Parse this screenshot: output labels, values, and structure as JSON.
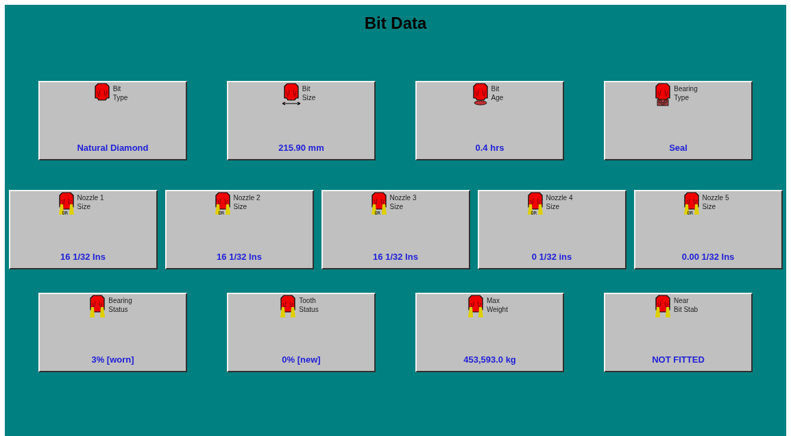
{
  "title": "Bit Data",
  "rows": [
    [
      {
        "kind": "plain",
        "label_lines": [
          "Bit",
          "Type"
        ],
        "value": "Natural Diamond"
      },
      {
        "kind": "size",
        "label_lines": [
          "Bit",
          "Size"
        ],
        "value": "215.90 mm"
      },
      {
        "kind": "age",
        "label_lines": [
          "Bit",
          "Age"
        ],
        "value": "0.4 hrs"
      },
      {
        "kind": "bearing",
        "label_lines": [
          "Bearing",
          "Type"
        ],
        "value": "Seal"
      }
    ],
    [
      {
        "kind": "nozzle",
        "nozzle_mark": "OR",
        "label_lines": [
          "Nozzle 1",
          "Size"
        ],
        "value": "16 1/32 Ins"
      },
      {
        "kind": "nozzle",
        "nozzle_mark": "OR",
        "label_lines": [
          "Nozzle 2",
          "Size"
        ],
        "value": "16 1/32 Ins"
      },
      {
        "kind": "nozzle",
        "nozzle_mark": "OR",
        "label_lines": [
          "Nozzle 3",
          "Size"
        ],
        "value": "16 1/32 Ins"
      },
      {
        "kind": "nozzle",
        "nozzle_mark": "OR",
        "label_lines": [
          "Nozzle 4",
          "Size"
        ],
        "value": "0 1/32 ins"
      },
      {
        "kind": "nozzle",
        "nozzle_mark": "OR",
        "label_lines": [
          "Nozzle 5",
          "Size"
        ],
        "value": "0.00 1/32 Ins"
      }
    ],
    [
      {
        "kind": "jets",
        "label_lines": [
          "Bearing",
          "Status"
        ],
        "value": "3% [worn]"
      },
      {
        "kind": "jets",
        "label_lines": [
          "Tooth",
          "Status"
        ],
        "value": "0% [new]"
      },
      {
        "kind": "jets",
        "label_lines": [
          "Max",
          "Weight"
        ],
        "value": "453,593.0 kg"
      },
      {
        "kind": "jets",
        "label_lines": [
          "Near",
          "Bit Stab"
        ],
        "value": "NOT FITTED"
      }
    ]
  ]
}
